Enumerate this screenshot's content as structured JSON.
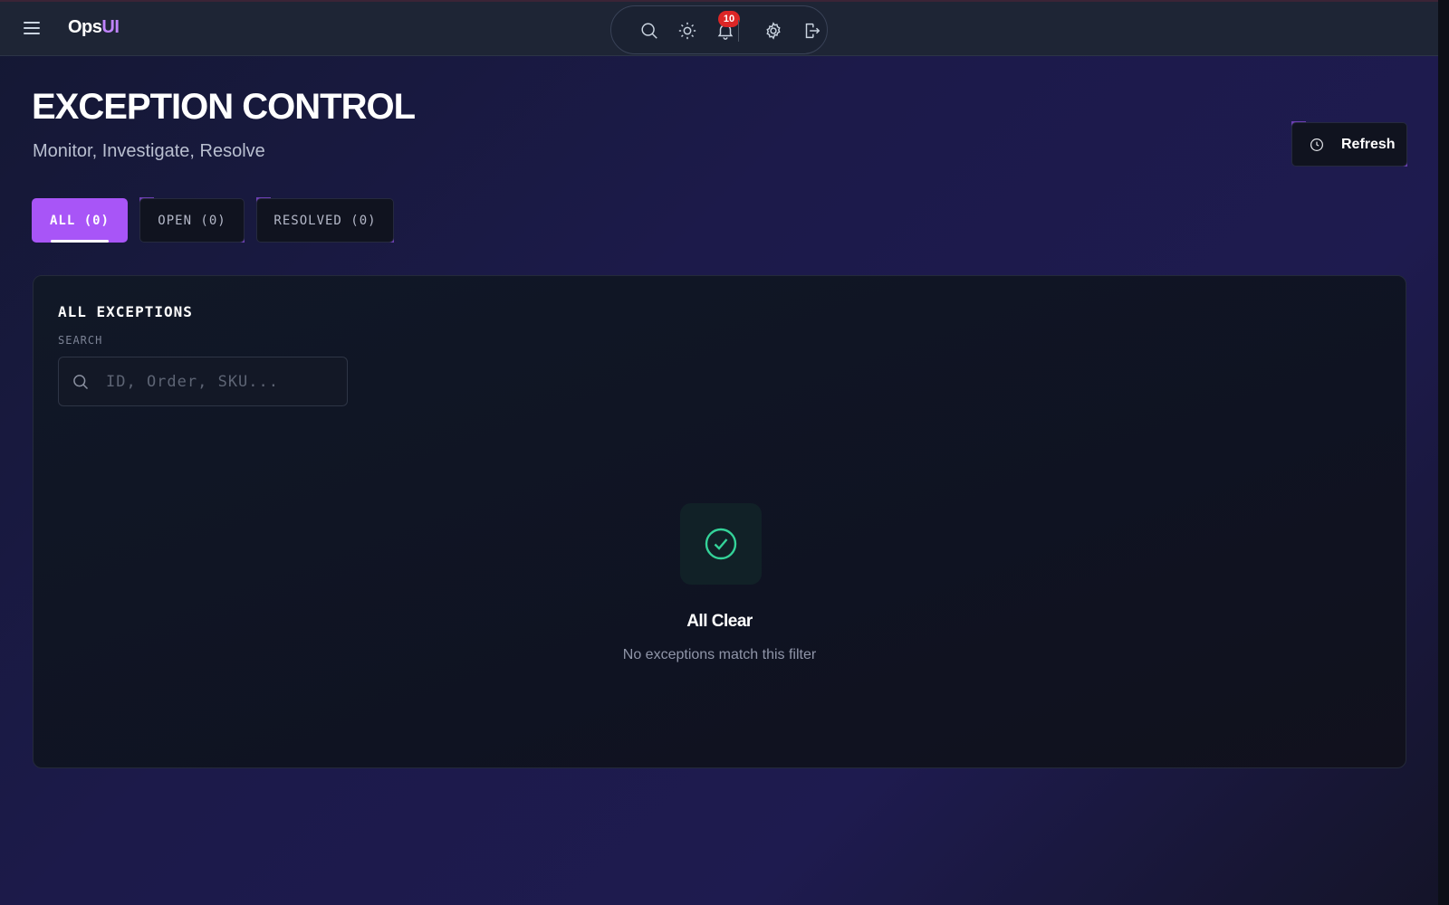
{
  "app": {
    "brand_part1": "Ops",
    "brand_part2": "UI",
    "notification_count": "10"
  },
  "header": {
    "title": "EXCEPTION CONTROL",
    "subtitle": "Monitor, Investigate, Resolve",
    "refresh_label": "Refresh"
  },
  "tabs": [
    {
      "label": "ALL (0)",
      "active": true
    },
    {
      "label": "OPEN (0)",
      "active": false
    },
    {
      "label": "RESOLVED (0)",
      "active": false
    }
  ],
  "panel": {
    "title": "ALL EXCEPTIONS",
    "search_label": "SEARCH",
    "search_placeholder": "ID, Order, SKU...",
    "search_value": ""
  },
  "empty_state": {
    "title": "All Clear",
    "message": "No exceptions match this filter"
  },
  "icons": {
    "menu": "hamburger-menu-icon",
    "search": "search-icon",
    "theme": "sun-icon",
    "notifications": "bell-icon",
    "settings": "gear-icon",
    "logout": "logout-icon",
    "refresh": "clock-icon",
    "empty": "check-circle-icon"
  },
  "colors": {
    "accent": "#a855f7",
    "brand_accent": "#c084fc",
    "success": "#34d399",
    "badge": "#dc2626"
  }
}
